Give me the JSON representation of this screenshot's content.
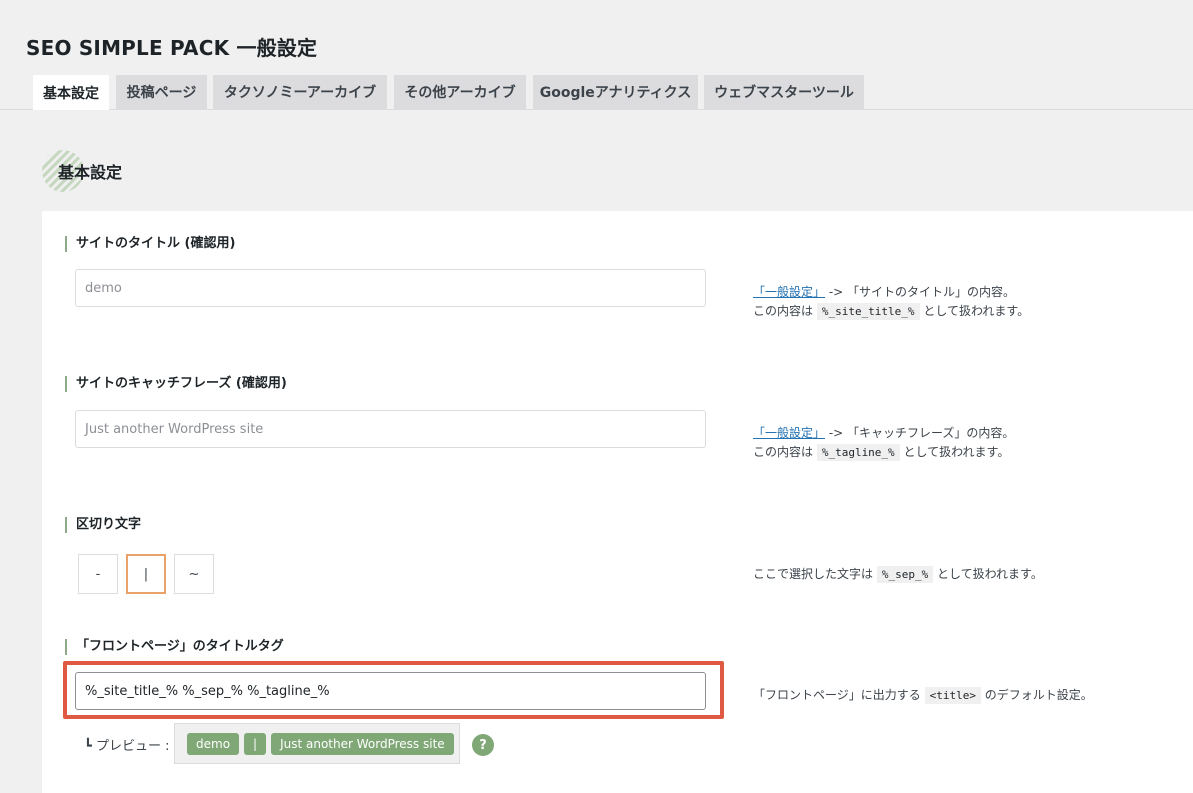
{
  "page_title": "SEO SIMPLE PACK 一般設定",
  "tabs": [
    {
      "label": "基本設定",
      "active": true
    },
    {
      "label": "投稿ページ"
    },
    {
      "label": "タクソノミーアーカイブ"
    },
    {
      "label": "その他アーカイブ"
    },
    {
      "label": "Googleアナリティクス"
    },
    {
      "label": "ウェブマスターツール"
    }
  ],
  "section": {
    "title": "基本設定",
    "deco_icon": "striped-circle-icon"
  },
  "fields": {
    "site_title": {
      "label": "サイトのタイトル (確認用)",
      "value": "demo",
      "desc_link": "「一般設定」",
      "desc_line1_rest": " -> 「サイトのタイトル」の内容。",
      "desc_line2_pre": "この内容は ",
      "desc_code": "%_site_title_%",
      "desc_line2_post": " として扱われます。"
    },
    "tagline": {
      "label": "サイトのキャッチフレーズ (確認用)",
      "value": "Just another WordPress site",
      "desc_link": "「一般設定」",
      "desc_line1_rest": " -> 「キャッチフレーズ」の内容。",
      "desc_line2_pre": "この内容は ",
      "desc_code": "%_tagline_%",
      "desc_line2_post": " として扱われます。"
    },
    "separator": {
      "label": "区切り文字",
      "options": [
        "-",
        "|",
        "~"
      ],
      "selected": "|",
      "desc_pre": "ここで選択した文字は ",
      "desc_code": "%_sep_%",
      "desc_post": " として扱われます。"
    },
    "front_title": {
      "label": "「フロントページ」のタイトルタグ",
      "value": "%_site_title_% %_sep_% %_tagline_%",
      "desc_pre": "「フロントページ」に出力する ",
      "desc_code": "<title>",
      "desc_post": " のデフォルト設定。",
      "preview_label": "┗ プレビュー :",
      "preview_chips": [
        "demo",
        "|",
        "Just another WordPress site"
      ],
      "help_label": "?"
    }
  },
  "colors": {
    "accent_green": "#7fa876",
    "highlight_red": "#e05a43",
    "selected_orange": "#e8a26a",
    "link_blue": "#2271b1"
  }
}
